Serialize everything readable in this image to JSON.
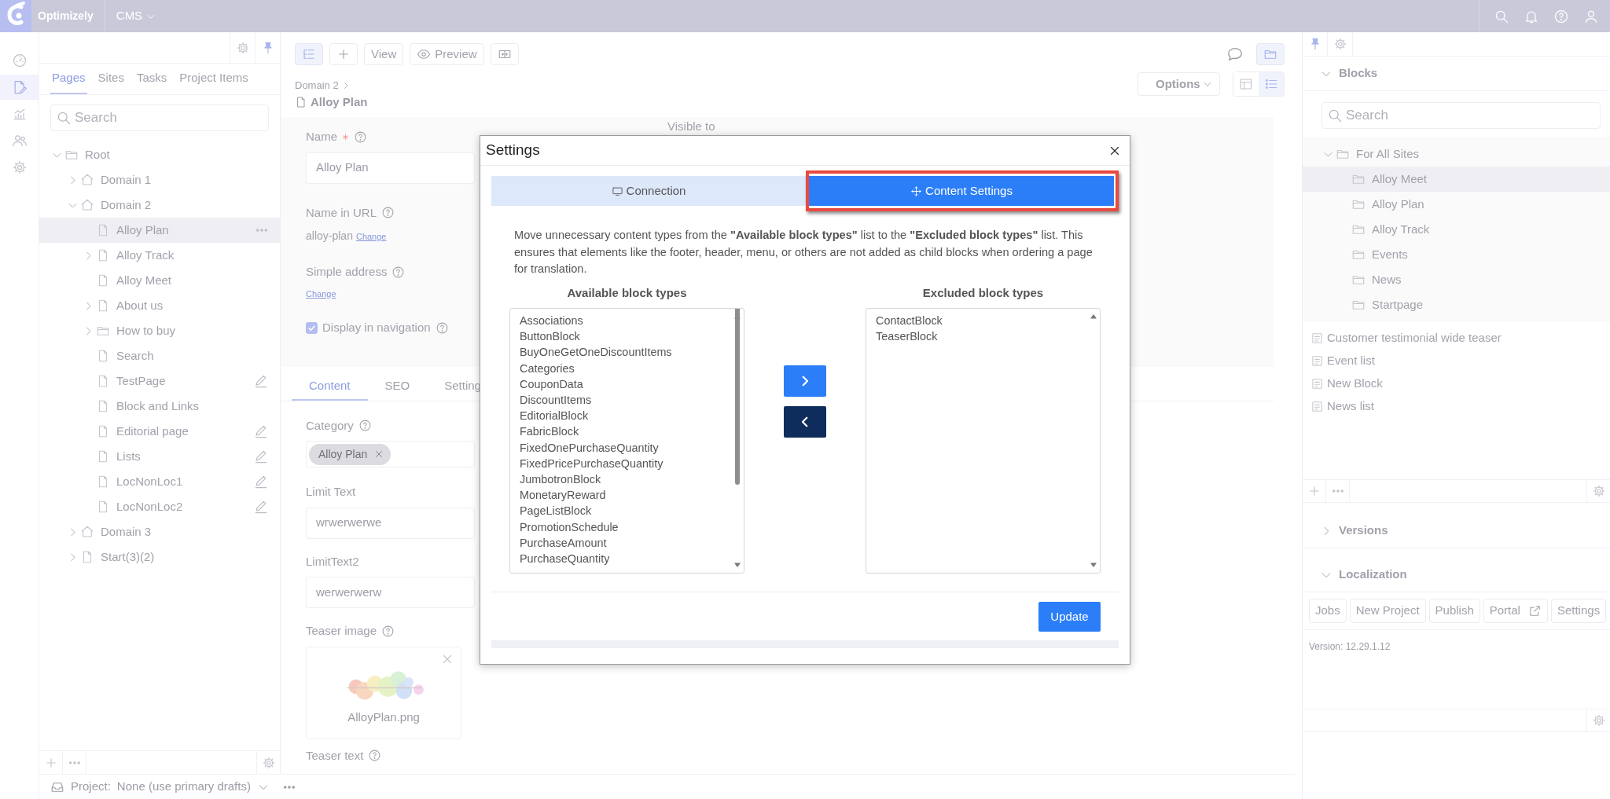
{
  "topbar": {
    "brand": "Optimizely",
    "product": "CMS"
  },
  "rail": [
    {
      "kind": "dashboard",
      "selected": false
    },
    {
      "kind": "edit",
      "selected": true
    },
    {
      "kind": "chart",
      "selected": false
    },
    {
      "kind": "people",
      "selected": false
    },
    {
      "kind": "gear",
      "selected": false
    }
  ],
  "left_panel": {
    "tabs": [
      {
        "label": "Pages",
        "selected": true
      },
      {
        "label": "Sites",
        "selected": false
      },
      {
        "label": "Tasks",
        "selected": false
      },
      {
        "label": "Project Items",
        "selected": false
      }
    ],
    "search": {
      "placeholder": "Search"
    },
    "tree": [
      {
        "label": "Root",
        "kind": "folder",
        "expandable": true,
        "expanded": true,
        "selected": false,
        "edited": false,
        "children": [
          {
            "label": "Domain 1",
            "kind": "home",
            "expandable": true,
            "expanded": false,
            "selected": false,
            "edited": false
          },
          {
            "label": "Domain 2",
            "kind": "home",
            "expandable": true,
            "expanded": true,
            "selected": false,
            "edited": false,
            "children": [
              {
                "label": "Alloy Plan",
                "kind": "page",
                "expandable": false,
                "selected": true,
                "edited": false
              },
              {
                "label": "Alloy Track",
                "kind": "page",
                "expandable": true,
                "expanded": false,
                "selected": false,
                "edited": false
              },
              {
                "label": "Alloy Meet",
                "kind": "page",
                "expandable": false,
                "selected": false,
                "edited": false
              },
              {
                "label": "About us",
                "kind": "page",
                "expandable": true,
                "expanded": false,
                "selected": false,
                "edited": false
              },
              {
                "label": "How to buy",
                "kind": "folder",
                "expandable": true,
                "expanded": false,
                "selected": false,
                "edited": false
              },
              {
                "label": "Search",
                "kind": "page",
                "expandable": false,
                "selected": false,
                "edited": false
              },
              {
                "label": "TestPage",
                "kind": "page",
                "expandable": false,
                "selected": false,
                "edited": true
              },
              {
                "label": "Block and Links",
                "kind": "page",
                "expandable": false,
                "selected": false,
                "edited": false
              },
              {
                "label": "Editorial page",
                "kind": "page",
                "expandable": false,
                "selected": false,
                "edited": true
              },
              {
                "label": "Lists",
                "kind": "page",
                "expandable": false,
                "selected": false,
                "edited": true
              },
              {
                "label": "LocNonLoc1",
                "kind": "page",
                "expandable": false,
                "selected": false,
                "edited": true
              },
              {
                "label": "LocNonLoc2",
                "kind": "page",
                "expandable": false,
                "selected": false,
                "edited": true
              }
            ]
          },
          {
            "label": "Domain 3",
            "kind": "home",
            "expandable": true,
            "expanded": false,
            "selected": false,
            "edited": false
          },
          {
            "label": "Start(3)(2)",
            "kind": "page",
            "expandable": true,
            "expanded": false,
            "selected": false,
            "edited": false
          }
        ]
      }
    ]
  },
  "project_bar": {
    "label": "Project:",
    "value": "None (use primary drafts)"
  },
  "editor": {
    "toolbar": [
      {
        "kind": "tree",
        "selected": true
      },
      {
        "kind": "plus",
        "selected": false
      },
      {
        "kind": "text",
        "label": "View",
        "selected": false
      },
      {
        "kind": "eye",
        "label": "Preview",
        "selected": false
      },
      {
        "kind": "split",
        "selected": false
      }
    ],
    "breadcrumb": "Domain 2",
    "title": "Alloy Plan",
    "options": "Options",
    "view_toggles": [
      {
        "kind": "layout",
        "selected": false
      },
      {
        "kind": "list",
        "selected": true
      }
    ],
    "visible_to": "Visible to",
    "top_fields": [
      {
        "kind": "text",
        "label": "Name",
        "required": true,
        "value": "Alloy Plan"
      },
      {
        "kind": "url",
        "label": "Name in URL",
        "required": false,
        "value": "alloy-plan",
        "link": "Change"
      },
      {
        "kind": "link",
        "label": "Simple address",
        "required": false,
        "link": "Change"
      },
      {
        "kind": "checkbox",
        "label": "Display in navigation",
        "required": false,
        "checked": true
      }
    ],
    "tabs": [
      {
        "label": "Content",
        "selected": true
      },
      {
        "label": "SEO",
        "selected": false
      },
      {
        "label": "Setting",
        "selected": false
      }
    ],
    "fields": [
      {
        "kind": "tags",
        "label": "Category",
        "help": true,
        "tags": [
          "Alloy Plan"
        ]
      },
      {
        "kind": "text",
        "label": "Limit Text",
        "help": false,
        "value": "wrwerwerwe"
      },
      {
        "kind": "text",
        "label": "LimitText2",
        "help": false,
        "value": "werwerwerw"
      },
      {
        "label": "Teaser image",
        "help": true,
        "filename": "AlloyPlan.png"
      },
      {
        "kind": "label",
        "label": "Teaser text",
        "help": true
      }
    ]
  },
  "right_panel": {
    "blocks": {
      "title": "Blocks",
      "expanded": true,
      "search": {
        "placeholder": "Search"
      },
      "tree": [
        {
          "label": "For All Sites",
          "kind": "folder",
          "expandable": true,
          "expanded": true,
          "selected": false,
          "children": [
            {
              "label": "Alloy Meet",
              "kind": "folder",
              "expandable": false,
              "selected": true
            },
            {
              "label": "Alloy Plan",
              "kind": "folder",
              "expandable": false,
              "selected": false
            },
            {
              "label": "Alloy Track",
              "kind": "folder",
              "expandable": false,
              "selected": false
            },
            {
              "label": "Events",
              "kind": "folder",
              "expandable": false,
              "selected": false
            },
            {
              "label": "News",
              "kind": "folder",
              "expandable": false,
              "selected": false
            },
            {
              "label": "Startpage",
              "kind": "folder",
              "expandable": false,
              "selected": false
            }
          ]
        }
      ],
      "items": [
        "Customer testimonial wide teaser",
        "Event list",
        "New Block",
        "News list"
      ]
    },
    "versions": {
      "title": "Versions",
      "expanded": false
    },
    "localization": {
      "title": "Localization",
      "expanded": true,
      "buttons": [
        {
          "label": "Jobs",
          "external": false
        },
        {
          "label": "New Project",
          "external": false
        },
        {
          "label": "Publish",
          "external": false
        },
        {
          "label": "Portal",
          "external": true
        },
        {
          "label": "Settings",
          "external": false
        }
      ],
      "version": "Version: 12.29.1.12"
    }
  },
  "dialog": {
    "title": "Settings",
    "tabs": [
      {
        "label": "Connection",
        "kind": "monitor",
        "selected": false,
        "highlighted": false
      },
      {
        "label": "Content Settings",
        "kind": "move",
        "selected": true,
        "highlighted": true
      }
    ],
    "description": "Move unnecessary content types from the **\"Available block types\"** list to the **\"Excluded block types\"** list. This ensures that elements like the footer, header, menu, or others are not added as child blocks when ordering a page for translation.",
    "available": {
      "title": "Available block types",
      "items": [
        "Associations",
        "ButtonBlock",
        "BuyOneGetOneDiscountItems",
        "Categories",
        "CouponData",
        "DiscountItems",
        "EditorialBlock",
        "FabricBlock",
        "FixedOnePurchaseQuantity",
        "FixedPricePurchaseQuantity",
        "JumbotronBlock",
        "MonetaryReward",
        "PageListBlock",
        "PromotionSchedule",
        "PurchaseAmount",
        "PurchaseQuantity"
      ]
    },
    "excluded": {
      "title": "Excluded block types",
      "items": [
        "ContactBlock",
        "TeaserBlock"
      ]
    },
    "update": "Update"
  }
}
